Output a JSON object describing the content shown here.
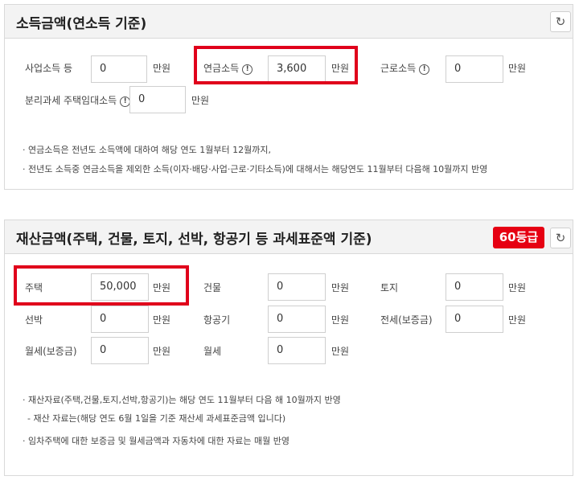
{
  "income": {
    "title": "소득금액(연소득 기준)",
    "fields": [
      {
        "label": "사업소득 등",
        "value": "0",
        "unit": "만원"
      },
      {
        "label": "연금소득",
        "value": "3,600",
        "unit": "만원"
      },
      {
        "label": "근로소득",
        "value": "0",
        "unit": "만원"
      },
      {
        "label": "분리과세 주택임대소득",
        "value": "0",
        "unit": "만원"
      }
    ],
    "notes": [
      "· 연금소득은 전년도 소득액에 대하여 해당 연도 1월부터 12월까지,",
      "· 전년도 소득중 연금소득을 제외한 소득(이자·배당·사업·근로·기타소득)에 대해서는 해당연도 11월부터 다음해 10월까지 반영"
    ]
  },
  "property": {
    "title": "재산금액(주택, 건물, 토지, 선박, 항공기 등 과세표준액 기준)",
    "grade": "60등급",
    "fields": [
      {
        "label": "주택",
        "value": "50,000",
        "unit": "만원"
      },
      {
        "label": "건물",
        "value": "0",
        "unit": "만원"
      },
      {
        "label": "토지",
        "value": "0",
        "unit": "만원"
      },
      {
        "label": "선박",
        "value": "0",
        "unit": "만원"
      },
      {
        "label": "항공기",
        "value": "0",
        "unit": "만원"
      },
      {
        "label": "전세(보증금)",
        "value": "0",
        "unit": "만원"
      },
      {
        "label": "월세(보증금)",
        "value": "0",
        "unit": "만원"
      },
      {
        "label": "월세",
        "value": "0",
        "unit": "만원"
      }
    ],
    "notes": [
      "· 재산자료(주택,건물,토지,선박,항공기)는 해당 연도 11월부터 다음 해 10월까지 반영",
      "- 재산 자료는(해당 연도 6월 1일을 기준 재산세 과세표준금액 입니다)",
      "· 임차주택에 대한 보증금 및 월세금액과 자동차에 대한 자료는 매월 반영"
    ]
  },
  "icons": {
    "reset": "↻",
    "info": "!"
  },
  "colors": {
    "highlight": "#e0001b",
    "badge": "#e60012"
  }
}
